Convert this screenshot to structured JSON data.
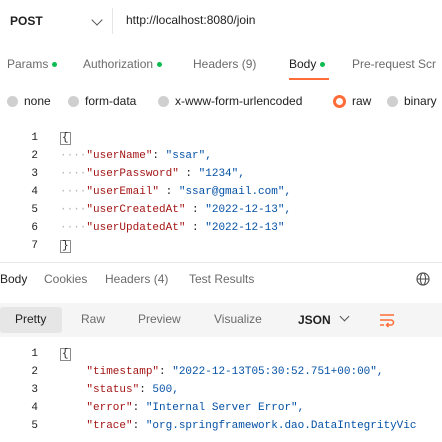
{
  "request": {
    "method": "POST",
    "url": "http://localhost:8080/join"
  },
  "request_tabs": [
    {
      "label": "Params",
      "dot": true,
      "active": false
    },
    {
      "label": "Authorization",
      "dot": true,
      "active": false
    },
    {
      "label": "Headers (9)",
      "dot": false,
      "active": false
    },
    {
      "label": "Body",
      "dot": true,
      "active": true
    },
    {
      "label": "Pre-request Scr",
      "dot": false,
      "active": false
    }
  ],
  "body_types": [
    {
      "label": "none",
      "selected": false
    },
    {
      "label": "form-data",
      "selected": false
    },
    {
      "label": "x-www-form-urlencoded",
      "selected": false
    },
    {
      "label": "raw",
      "selected": true
    },
    {
      "label": "binary",
      "selected": false
    }
  ],
  "request_body": {
    "line_numbers": [
      "1",
      "2",
      "3",
      "4",
      "5",
      "6",
      "7"
    ],
    "open_brace": "{",
    "close_brace": "}",
    "fields": [
      {
        "key": "\"userName\"",
        "sep": ": ",
        "value": "\"ssar\","
      },
      {
        "key": "\"userPassword\"",
        "sep": " : ",
        "value": "\"1234\","
      },
      {
        "key": "\"userEmail\"",
        "sep": " : ",
        "value": "\"ssar@gmail.com\","
      },
      {
        "key": "\"userCreatedAt\"",
        "sep": " : ",
        "value": "\"2022-12-13\","
      },
      {
        "key": "\"userUpdatedAt\"",
        "sep": " : ",
        "value": "\"2022-12-13\""
      }
    ]
  },
  "response_tabs": [
    {
      "label": "Body",
      "active": true
    },
    {
      "label": "Cookies",
      "active": false
    },
    {
      "label": "Headers (4)",
      "active": false
    },
    {
      "label": "Test Results",
      "active": false
    }
  ],
  "format_options": {
    "pretty": "Pretty",
    "raw": "Raw",
    "preview": "Preview",
    "visualize": "Visualize",
    "selected_language": "JSON"
  },
  "response_body": {
    "line_numbers": [
      "1",
      "2",
      "3",
      "4",
      "5"
    ],
    "open_brace": "{",
    "fields": [
      {
        "key": "\"timestamp\"",
        "sep": ": ",
        "value": "\"2022-12-13T05:30:52.751+00:00\","
      },
      {
        "key": "\"status\"",
        "sep": ": ",
        "value": "500,"
      },
      {
        "key": "\"error\"",
        "sep": ": ",
        "value": "\"Internal Server Error\","
      },
      {
        "key": "\"trace\"",
        "sep": ": ",
        "value": "\"org.springframework.dao.DataIntegrityVic"
      }
    ]
  },
  "colors": {
    "accent": "#ff6c37",
    "status_dot": "#0cbb52",
    "json_key": "#a31515",
    "json_string": "#0451a5"
  }
}
